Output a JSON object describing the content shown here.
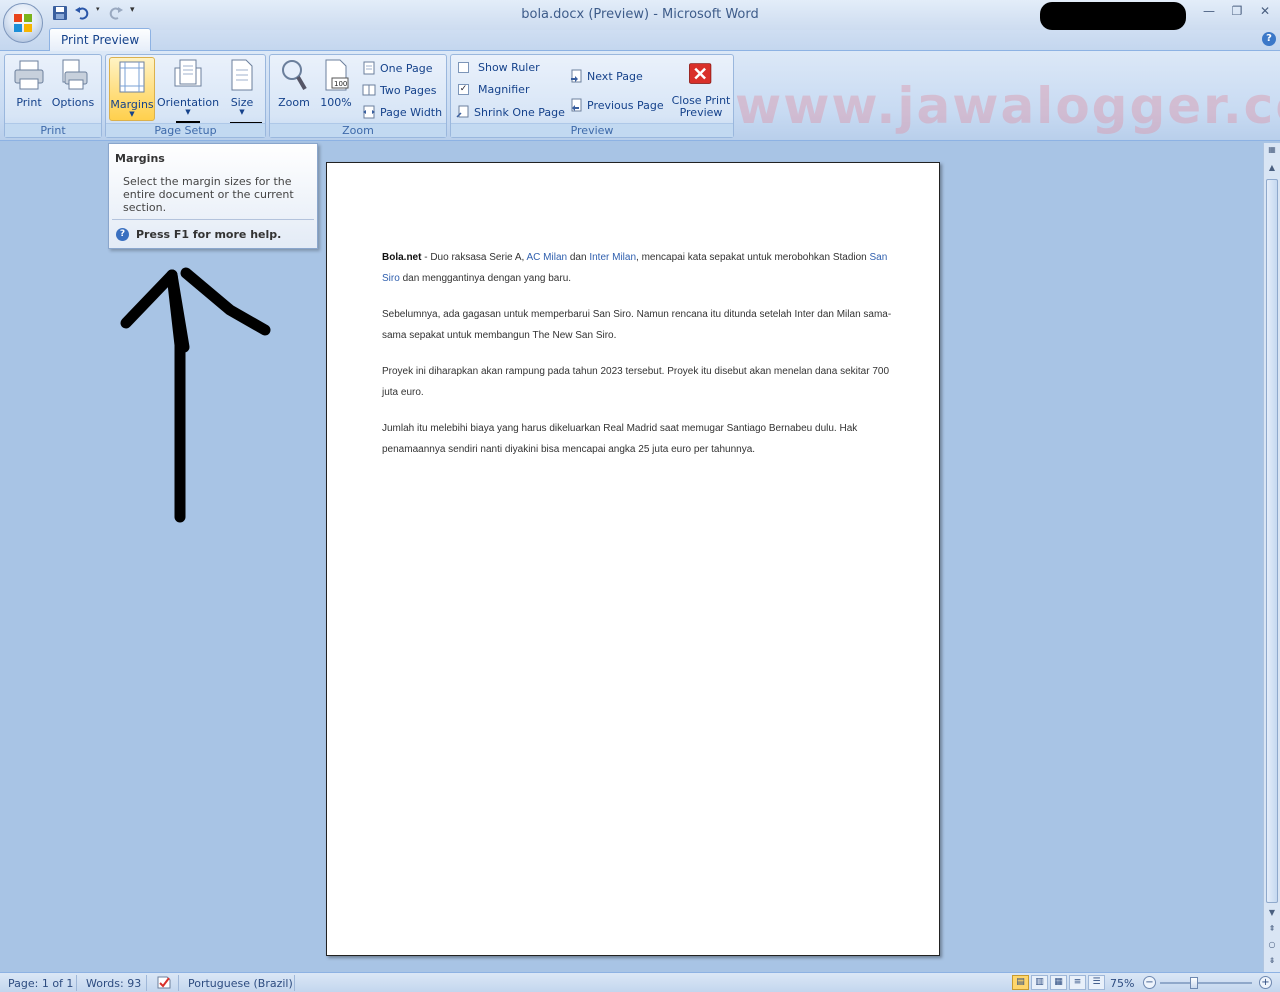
{
  "window": {
    "title": "bola.docx (Preview) - Microsoft Word"
  },
  "ribbon": {
    "tab_label": "Print Preview",
    "groups": {
      "print": {
        "label": "Print",
        "print_label": "Print",
        "options_label": "Options"
      },
      "page_setup": {
        "label": "Page Setup",
        "margins_label": "Margins",
        "orientation_label": "Orientation",
        "size_label": "Size"
      },
      "zoom": {
        "label": "Zoom",
        "zoom_label": "Zoom",
        "hundred_label": "100%",
        "one_page_label": "One Page",
        "two_pages_label": "Two Pages",
        "page_width_label": "Page Width"
      },
      "preview": {
        "label": "Preview",
        "show_ruler_label": "Show Ruler",
        "show_ruler_checked": false,
        "magnifier_label": "Magnifier",
        "magnifier_checked": true,
        "shrink_label": "Shrink One Page",
        "next_page_label": "Next Page",
        "previous_page_label": "Previous Page",
        "close_label_1": "Close Print",
        "close_label_2": "Preview"
      }
    },
    "watermark": "www.jawalogger.com"
  },
  "tooltip": {
    "title": "Margins",
    "body": "Select the margin sizes for the entire document or the current section.",
    "help": "Press F1 for more help."
  },
  "document": {
    "p1": {
      "bold": "Bola.net",
      "t1": " - Duo raksasa Serie A, ",
      "link1": "AC Milan",
      "t2": " dan ",
      "link2": "Inter Milan",
      "t3": ", mencapai kata sepakat untuk merobohkan Stadion ",
      "link3": "San Siro",
      "t4": " dan menggantinya dengan yang baru."
    },
    "p2": "Sebelumnya, ada gagasan untuk memperbarui San Siro. Namun rencana itu ditunda setelah Inter dan Milan sama-sama sepakat untuk membangun The New San Siro.",
    "p3": "Proyek ini diharapkan akan rampung pada tahun 2023 tersebut. Proyek itu disebut akan menelan dana sekitar 700 juta euro.",
    "p4": "Jumlah itu melebihi biaya yang harus dikeluarkan Real Madrid saat memugar Santiago Bernabeu dulu. Hak penamaannya sendiri nanti diyakini bisa mencapai angka 25 juta euro per tahunnya."
  },
  "statusbar": {
    "page": "Page: 1 of 1",
    "words": "Words: 93",
    "language": "Portuguese (Brazil)",
    "zoom": "75%",
    "zoom_level_percent": 75
  },
  "colors": {
    "ribbon_blue": "#c7daf2",
    "workspace": "#a8c4e5",
    "highlight": "#ffd04d",
    "link": "#2f5fae",
    "close_red": "#d9302a"
  },
  "icons": [
    "office-logo-icon",
    "save-icon",
    "undo-icon",
    "redo-icon",
    "printer-icon",
    "print-options-icon",
    "margins-icon",
    "orientation-icon",
    "size-icon",
    "magnifier-zoom-icon",
    "hundred-percent-icon",
    "one-page-icon",
    "two-pages-icon",
    "page-width-icon",
    "next-page-icon",
    "previous-page-icon",
    "shrink-icon",
    "close-x-icon",
    "help-icon",
    "spelling-check-icon"
  ]
}
